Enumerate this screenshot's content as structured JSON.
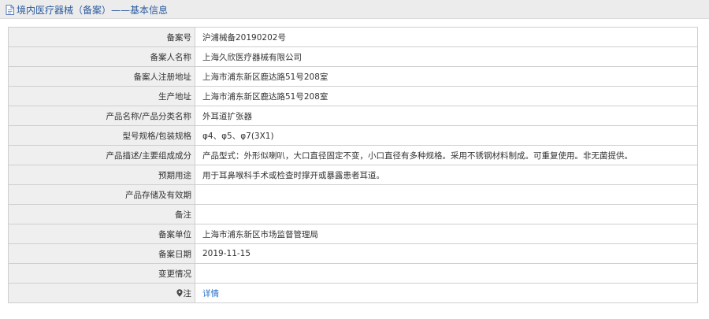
{
  "header": {
    "title": "境内医疗器械（备案）——基本信息"
  },
  "rows": [
    {
      "label": "备案号",
      "value": "沪浦械备20190202号"
    },
    {
      "label": "备案人名称",
      "value": "上海久欣医疗器械有限公司"
    },
    {
      "label": "备案人注册地址",
      "value": "上海市浦东新区鹿达路51号208室"
    },
    {
      "label": "生产地址",
      "value": "上海市浦东新区鹿达路51号208室"
    },
    {
      "label": "产品名称/产品分类名称",
      "value": "外耳道扩张器"
    },
    {
      "label": "型号规格/包装规格",
      "value": "φ4、φ5、φ7(3X1)"
    },
    {
      "label": "产品描述/主要组成成分",
      "value": "产品型式：外形似喇叭，大口直径固定不变，小口直径有多种规格。采用不锈钢材料制成。可重复使用。非无菌提供。"
    },
    {
      "label": "预期用途",
      "value": "用于耳鼻喉科手术或检查时撑开或暴露患者耳道。"
    },
    {
      "label": "产品存储及有效期",
      "value": ""
    },
    {
      "label": "备注",
      "value": ""
    },
    {
      "label": "备案单位",
      "value": "上海市浦东新区市场监督管理局"
    },
    {
      "label": "备案日期",
      "value": "2019-11-15"
    },
    {
      "label": "变更情况",
      "value": ""
    }
  ],
  "note_row": {
    "label": "注",
    "link_text": "详情",
    "icon": "map-pin-icon"
  },
  "colors": {
    "header_bg": "#ececec",
    "title_text": "#2a5a9e",
    "label_bg": "#efefef",
    "border": "#cfcfcf",
    "link": "#2a6fc9"
  }
}
